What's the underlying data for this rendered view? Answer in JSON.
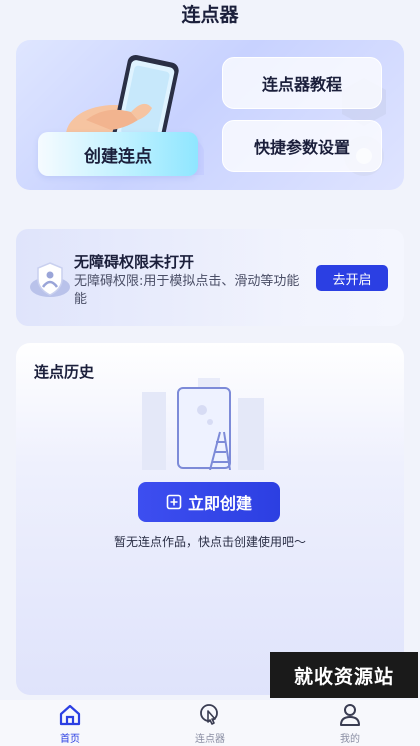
{
  "header": {
    "title": "连点器"
  },
  "hero": {
    "create_label": "创建连点",
    "tutorial_label": "连点器教程",
    "settings_label": "快捷参数设置"
  },
  "accessibility": {
    "title": "无障碍权限未打开",
    "description": "无障碍权限:用于模拟点击、滑动等功能能",
    "button_label": "去开启"
  },
  "history": {
    "title": "连点历史",
    "create_button_label": "立即创建",
    "empty_text": "暂无连点作品，快点击创建使用吧～"
  },
  "watermark": {
    "text": "就收资源站"
  },
  "tabbar": {
    "items": [
      {
        "label": "首页",
        "icon": "home-icon",
        "active": true
      },
      {
        "label": "连点器",
        "icon": "tap-icon",
        "active": false
      },
      {
        "label": "我的",
        "icon": "user-icon",
        "active": false
      }
    ]
  },
  "colors": {
    "accent": "#2b3fe3",
    "background": "#f1f3fb"
  }
}
